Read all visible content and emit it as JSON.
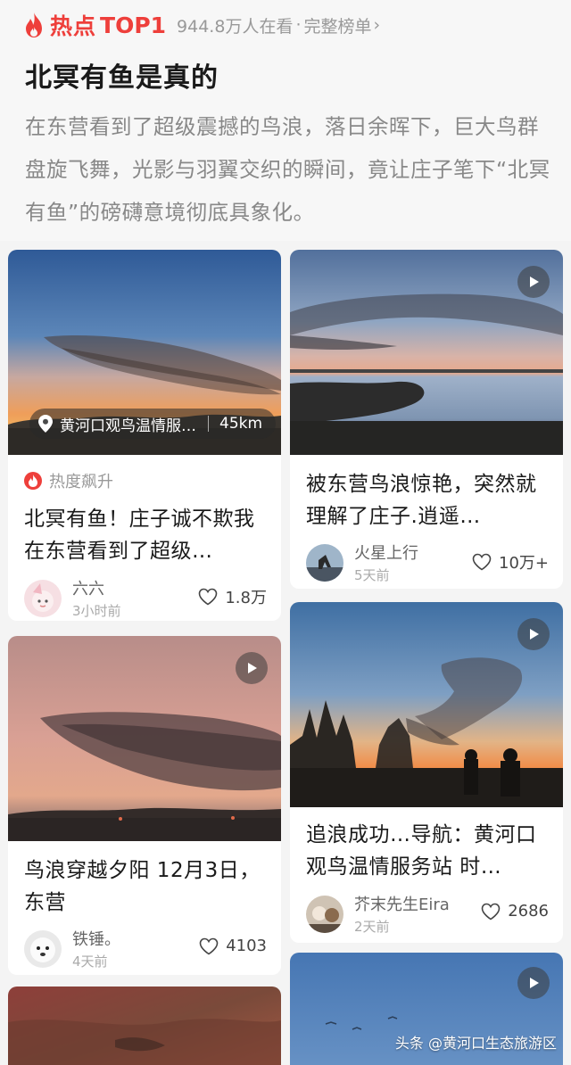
{
  "header": {
    "hot_label": "热点",
    "rank": "TOP1",
    "viewers": "944.8万人在看",
    "separator": "·",
    "full_list": "完整榜单",
    "chevron": "›",
    "title": "北冥有鱼是真的",
    "description": "在东营看到了超级震撼的鸟浪，落日余晖下，巨大鸟群盘旋飞舞，光影与羽翼交织的瞬间，竟让庄子笔下“北冥有鱼”的磅礴意境彻底具象化。"
  },
  "cards": [
    {
      "location": "黄河口观鸟温情服务站",
      "distance": "45km",
      "heat_tag": "热度飙升",
      "title": "北冥有鱼！庄子诚不欺我 在东营看到了超级…",
      "author": "六六",
      "time": "3小时前",
      "likes": "1.8万"
    },
    {
      "title": "被东营鸟浪惊艳，突然就理解了庄子.逍遥…",
      "author": "火星上行",
      "time": "5天前",
      "likes": "10万+"
    },
    {
      "title": "鸟浪穿越夕阳 12月3日，东营",
      "author": "铁锤。",
      "time": "4天前",
      "likes": "4103"
    },
    {
      "title": "追浪成功…导航：黄河口观鸟温情服务站 时…",
      "author": "芥末先生Eira",
      "time": "2天前",
      "likes": "2686"
    }
  ],
  "watermark": "头条 @黄河口生态旅游区",
  "colors": {
    "accent": "#ee3f3b",
    "muted": "#999999",
    "card_bg": "#ffffff",
    "page_bg": "#f4f4f4"
  },
  "icons": [
    "flame-icon",
    "chevron-right-icon",
    "location-pin-icon",
    "play-icon",
    "heart-outline-icon"
  ]
}
